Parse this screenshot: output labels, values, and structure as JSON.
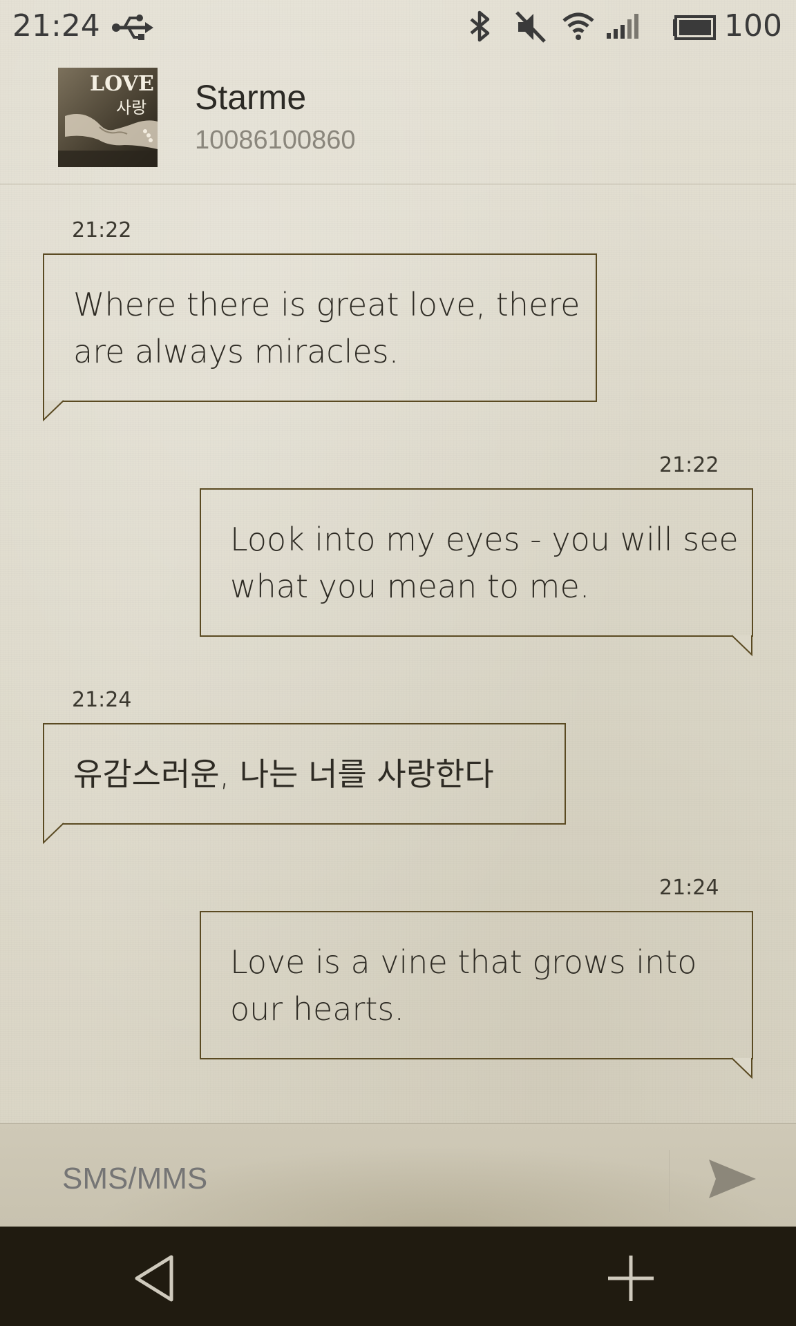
{
  "status_bar": {
    "time": "21:24",
    "battery": "100",
    "icons": [
      "usb-icon",
      "bluetooth-icon",
      "mute-icon",
      "wifi-icon",
      "signal-icon",
      "battery-icon"
    ]
  },
  "header": {
    "contact_name": "Starme",
    "contact_number": "10086100860",
    "avatar_text_en": "LOVE",
    "avatar_text_ko": "사랑"
  },
  "messages": [
    {
      "direction": "incoming",
      "time": "21:22",
      "lines": [
        "Where there is great love, there",
        "are always miracles."
      ]
    },
    {
      "direction": "outgoing",
      "time": "21:22",
      "lines": [
        "Look into my eyes - you will see",
        "what you mean to me."
      ]
    },
    {
      "direction": "incoming",
      "time": "21:24",
      "lines": [
        "유감스러운, 나는 너를 사랑한다"
      ]
    },
    {
      "direction": "outgoing",
      "time": "21:24",
      "lines": [
        "Love is a vine that grows into",
        "our hearts."
      ]
    }
  ],
  "composer": {
    "placeholder": "SMS/MMS",
    "send_icon": "send-icon"
  },
  "nav_bar": {
    "icons": [
      "back-icon",
      "add-icon"
    ]
  },
  "colors": {
    "bubble_border": "#5a4a22",
    "nav_background": "#201b10",
    "paper": "#dedacb"
  }
}
